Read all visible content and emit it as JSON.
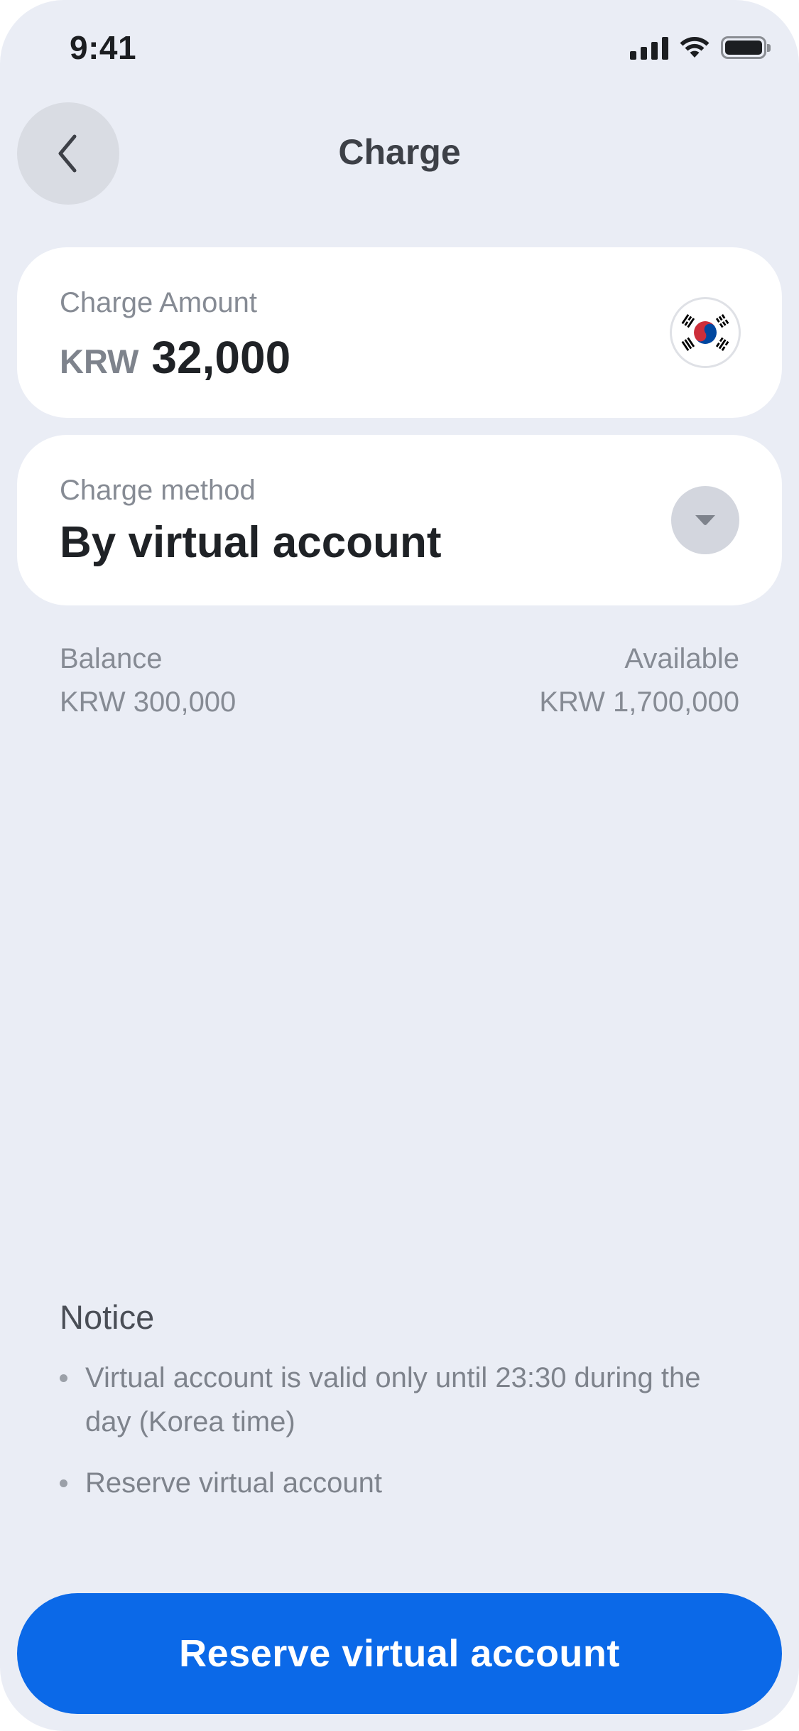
{
  "status_bar": {
    "time": "9:41"
  },
  "header": {
    "title": "Charge"
  },
  "amount_card": {
    "label": "Charge Amount",
    "currency": "KRW",
    "amount": "32,000",
    "flag_icon": "south-korea-flag-icon"
  },
  "method_card": {
    "label": "Charge method",
    "value": "By virtual account"
  },
  "balance": {
    "label": "Balance",
    "value": "KRW 300,000"
  },
  "available": {
    "label": "Available",
    "value": "KRW 1,700,000"
  },
  "notice": {
    "title": "Notice",
    "items": [
      "Virtual account is valid only until 23:30 during the day (Korea time)",
      "Reserve virtual account"
    ]
  },
  "cta": {
    "label": "Reserve virtual account",
    "color": "#0b69e8"
  }
}
